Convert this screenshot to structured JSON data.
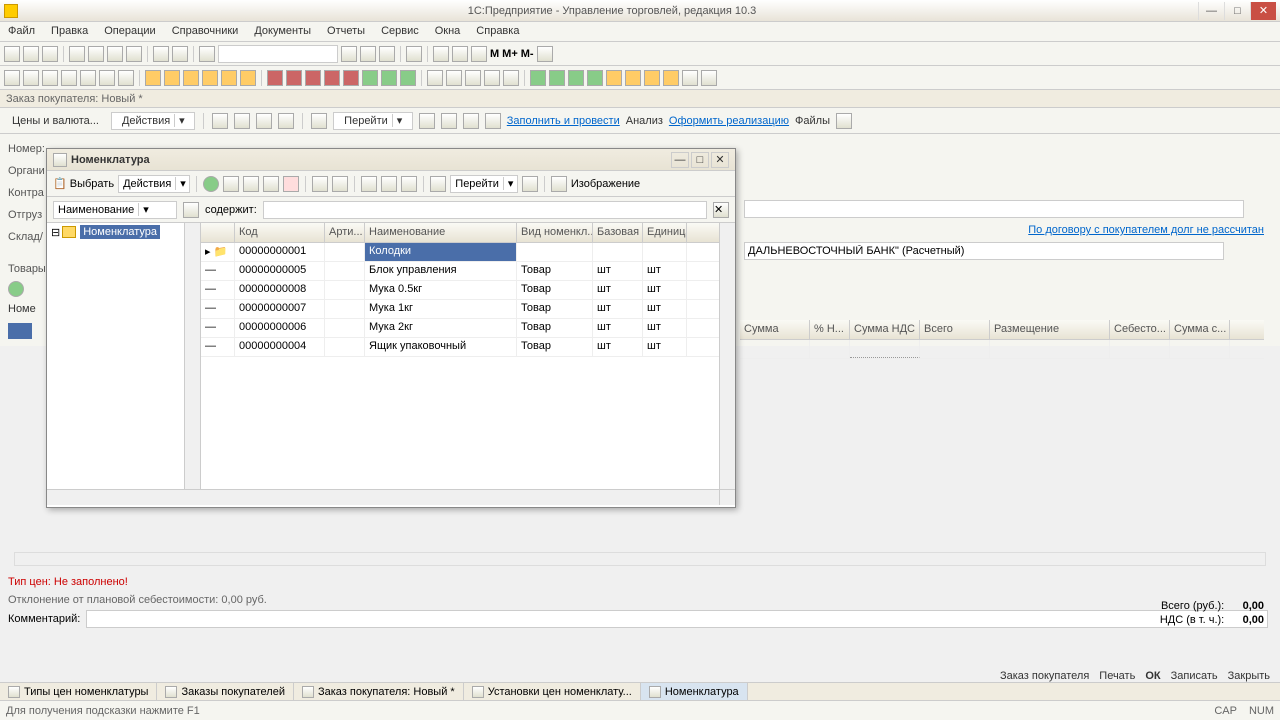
{
  "app": {
    "title": "1С:Предприятие - Управление торговлей, редакция 10.3"
  },
  "menu": [
    "Файл",
    "Правка",
    "Операции",
    "Справочники",
    "Документы",
    "Отчеты",
    "Сервис",
    "Окна",
    "Справка"
  ],
  "toolbar2_text": {
    "m": "М",
    "mplus": "М+",
    "mminus": "М-"
  },
  "doc_tab": "Заказ покупателя: Новый *",
  "doc_toolbar": {
    "prices": "Цены и валюта...",
    "actions": "Действия",
    "goto": "Перейти",
    "fill": "Заполнить и провести",
    "analysis": "Анализ",
    "realize": "Оформить реализацию",
    "files": "Файлы"
  },
  "form": {
    "number": "Номер:",
    "org": "Органи",
    "contr": "Контра",
    "ship": "Отгруз",
    "store": "Склад/",
    "goods": "Товары"
  },
  "bg": {
    "bank": "ДАЛЬНЕВОСТОЧНЫЙ БАНК\" (Расчетный)",
    "debt": "По договору с покупателем долг не рассчитан",
    "cols": [
      "Сумма",
      "% Н...",
      "Сумма НДС",
      "Всего",
      "Размещение",
      "Себесто...",
      "Сумма с..."
    ]
  },
  "modal": {
    "title": "Номенклатура",
    "select": "Выбрать",
    "actions": "Действия",
    "goto": "Перейти",
    "image": "Изображение",
    "filter_label": "Наименование",
    "contains": "содержит:",
    "tree_root": "Номенклатура",
    "columns": [
      "",
      "Код",
      "Арти...",
      "Наименование",
      "Вид номенкл...",
      "Базовая",
      "Единица"
    ],
    "rows": [
      {
        "code": "00000000001",
        "name": "Колодки",
        "vid": "",
        "base": "",
        "unit": ""
      },
      {
        "code": "00000000005",
        "name": "Блок управления",
        "vid": "Товар",
        "base": "шт",
        "unit": "шт"
      },
      {
        "code": "00000000008",
        "name": "Мука 0.5кг",
        "vid": "Товар",
        "base": "шт",
        "unit": "шт"
      },
      {
        "code": "00000000007",
        "name": "Мука 1кг",
        "vid": "Товар",
        "base": "шт",
        "unit": "шт"
      },
      {
        "code": "00000000006",
        "name": "Мука 2кг",
        "vid": "Товар",
        "base": "шт",
        "unit": "шт"
      },
      {
        "code": "00000000004",
        "name": "Ящик упаковочный",
        "vid": "Товар",
        "base": "шт",
        "unit": "шт"
      }
    ]
  },
  "status": {
    "price_type": "Тип цен: Не заполнено!",
    "deviation": "Отклонение от плановой себестоимости: 0,00 руб.",
    "comment_label": "Комментарий:"
  },
  "totals": {
    "total_label": "Всего (руб.):",
    "total_val": "0,00",
    "vat_label": "НДС (в т. ч.):",
    "vat_val": "0,00"
  },
  "footer": {
    "order": "Заказ покупателя",
    "print": "Печать",
    "ok": "ОК",
    "save": "Записать",
    "close": "Закрыть"
  },
  "taskbar": [
    "Типы цен номенклатуры",
    "Заказы покупателей",
    "Заказ покупателя: Новый *",
    "Установки цен номенклату...",
    "Номенклатура"
  ],
  "statusbar": {
    "hint": "Для получения подсказки нажмите F1",
    "cap": "CAP",
    "num": "NUM"
  }
}
